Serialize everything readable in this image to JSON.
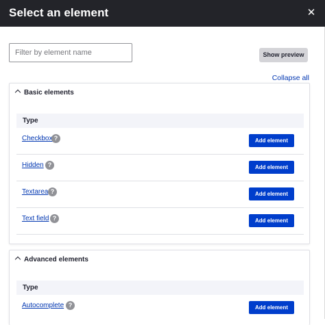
{
  "dialog": {
    "title": "Select an element",
    "close_glyph": "✕"
  },
  "toolbar": {
    "filter_placeholder": "Filter by element name",
    "filter_value": "",
    "show_preview_label": "Show preview",
    "collapse_all_label": "Collapse all"
  },
  "sections": [
    {
      "title": "Basic elements",
      "column_header": "Type",
      "rows": [
        {
          "name": "Checkbox",
          "help": "?",
          "button": "Add element"
        },
        {
          "name": "Hidden",
          "help": "?",
          "button": "Add element"
        },
        {
          "name": "Textarea",
          "help": "?",
          "button": "Add element"
        },
        {
          "name": "Text field",
          "help": "?",
          "button": "Add element"
        }
      ]
    },
    {
      "title": "Advanced elements",
      "column_header": "Type",
      "rows": [
        {
          "name": "Autocomplete",
          "help": "?",
          "button": "Add element"
        }
      ]
    }
  ],
  "colors": {
    "titlebar": "#232429",
    "link": "#0036b1",
    "primary_button": "#003ecc",
    "secondary_button": "#d4d4d8"
  },
  "icons": {
    "close": "close-icon",
    "chevron": "chevron-up-icon",
    "help": "help-icon"
  }
}
